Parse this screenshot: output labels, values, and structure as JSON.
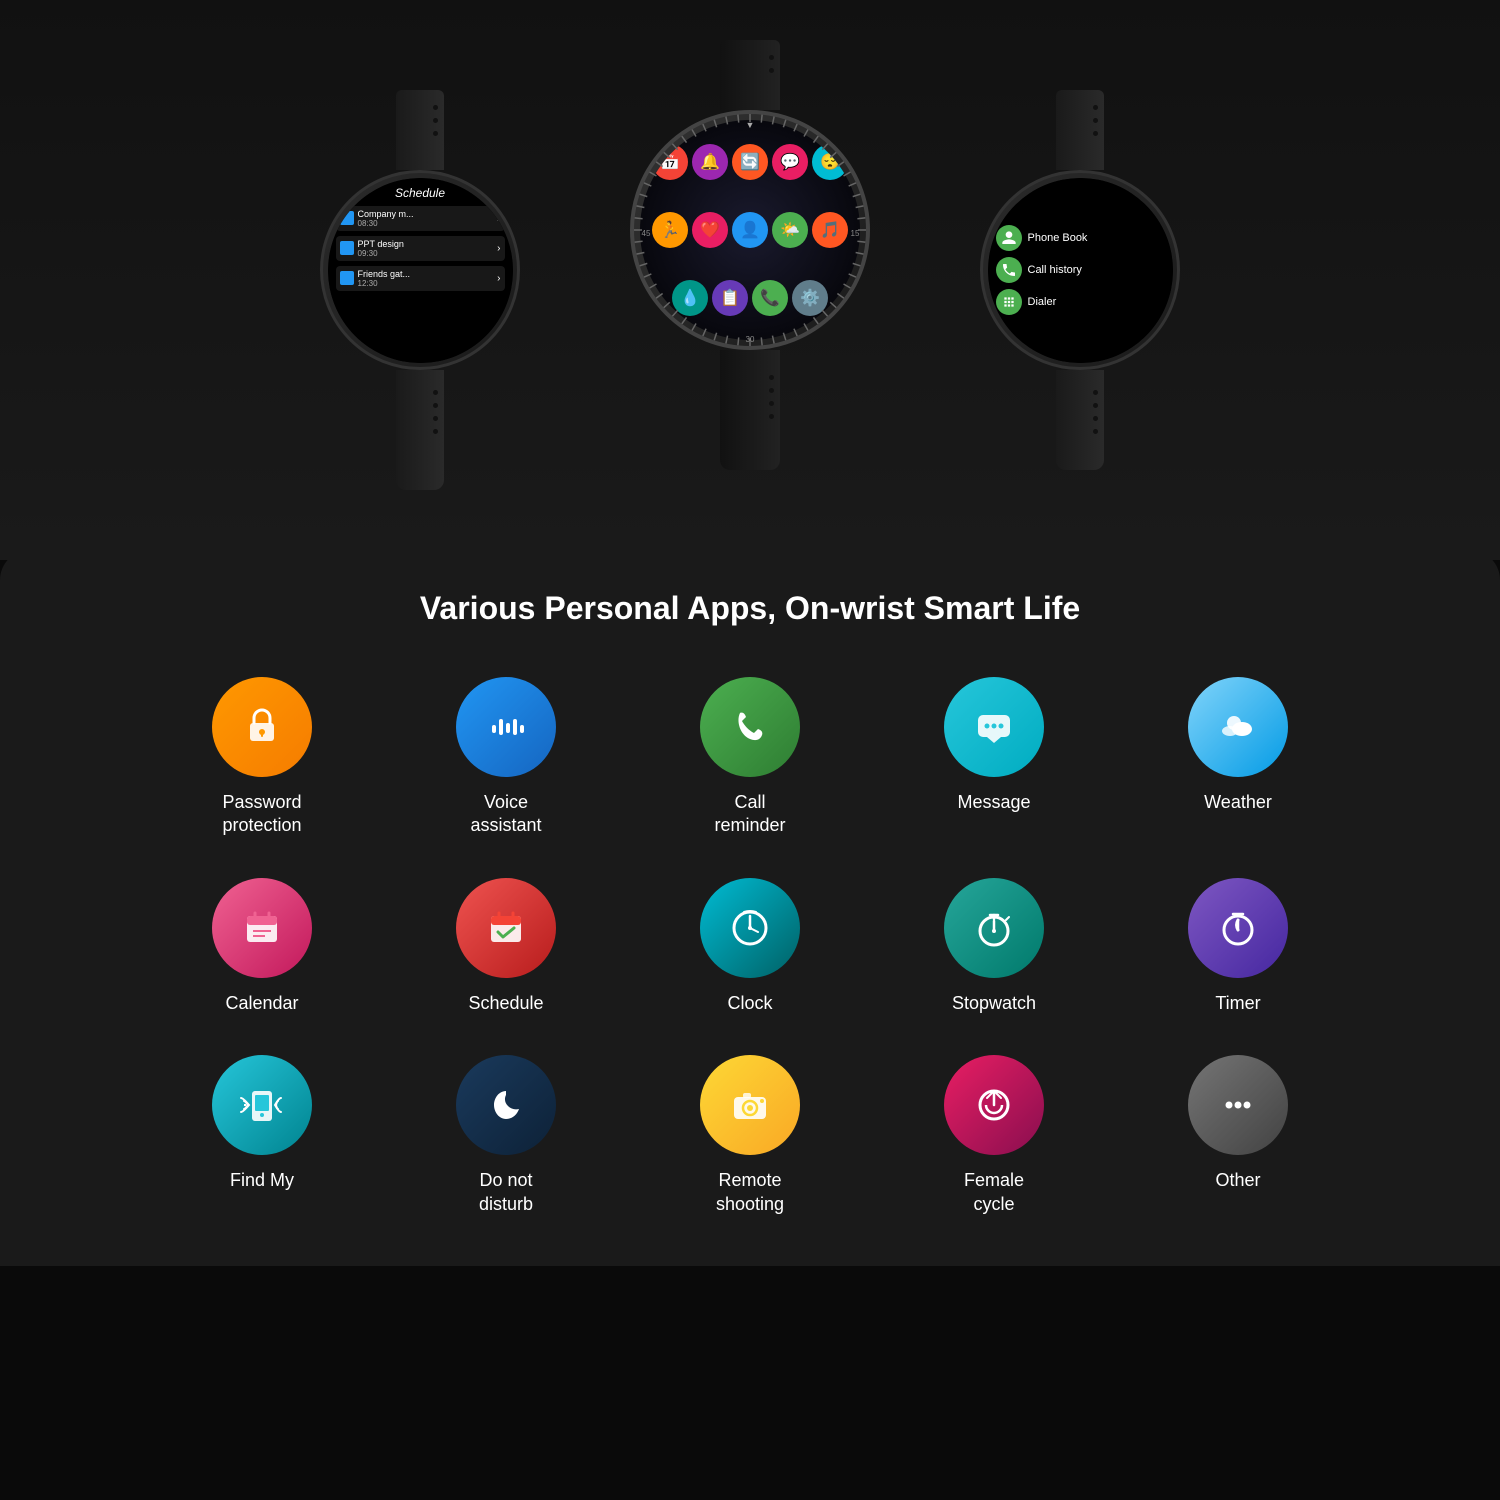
{
  "page": {
    "title": "Various Personal Apps, On-wrist Smart Life"
  },
  "watches": {
    "left": {
      "title": "Schedule",
      "items": [
        {
          "name": "Company m...",
          "time": "08:30"
        },
        {
          "name": "PPT design",
          "time": "09:30"
        },
        {
          "name": "Friends gat...",
          "time": "12:30"
        }
      ]
    },
    "right": {
      "items": [
        {
          "icon": "👤",
          "label": "Phone Book"
        },
        {
          "icon": "📞",
          "label": "Call history"
        },
        {
          "icon": "⌨️",
          "label": "Dialer"
        }
      ]
    }
  },
  "apps": [
    {
      "id": "password-protection",
      "label": "Password\nprotection",
      "color": "orange",
      "icon": "🔒"
    },
    {
      "id": "voice-assistant",
      "label": "Voice\nassistant",
      "color": "blue",
      "icon": "🎙️"
    },
    {
      "id": "call-reminder",
      "label": "Call\nreminder",
      "color": "green",
      "icon": "📞"
    },
    {
      "id": "message",
      "label": "Message",
      "color": "teal-light",
      "icon": "💬"
    },
    {
      "id": "weather",
      "label": "Weather",
      "color": "sky",
      "icon": "⛅"
    },
    {
      "id": "calendar",
      "label": "Calendar",
      "color": "pink",
      "icon": "📅"
    },
    {
      "id": "schedule",
      "label": "Schedule",
      "color": "red",
      "icon": "✅"
    },
    {
      "id": "clock",
      "label": "Clock",
      "color": "cyan",
      "icon": "⏰"
    },
    {
      "id": "stopwatch",
      "label": "Stopwatch",
      "color": "teal",
      "icon": "⏱️"
    },
    {
      "id": "timer",
      "label": "Timer",
      "color": "purple",
      "icon": "⏲️"
    },
    {
      "id": "find-my",
      "label": "Find My",
      "color": "teal2",
      "icon": "📱"
    },
    {
      "id": "do-not-disturb",
      "label": "Do not\ndisturb",
      "color": "dark-blue",
      "icon": "🌙"
    },
    {
      "id": "remote-shooting",
      "label": "Remote\nshooting",
      "color": "yellow",
      "icon": "📷"
    },
    {
      "id": "female-cycle",
      "label": "Female\ncycle",
      "color": "hot-pink",
      "icon": "♻️"
    },
    {
      "id": "other",
      "label": "Other",
      "color": "gray",
      "icon": "···"
    }
  ],
  "center_apps": [
    {
      "bg": "#F44336",
      "icon": "📅"
    },
    {
      "bg": "#9C27B0",
      "icon": "🔔"
    },
    {
      "bg": "#FF5722",
      "icon": "🔄"
    },
    {
      "bg": "#E91E63",
      "icon": "💬"
    },
    {
      "bg": "#00BCD4",
      "icon": "😴"
    },
    {
      "bg": "#FF9800",
      "icon": "🏃"
    },
    {
      "bg": "#E91E63",
      "icon": "❤️"
    },
    {
      "bg": "#2196F3",
      "icon": "👤"
    },
    {
      "bg": "#4CAF50",
      "icon": "🌤️"
    },
    {
      "bg": "#FF5722",
      "icon": "🎵"
    },
    {
      "bg": "#009688",
      "icon": "💧"
    },
    {
      "bg": "#673AB7",
      "icon": "📋"
    },
    {
      "bg": "#4CAF50",
      "icon": "📞"
    },
    {
      "bg": "#607D8B",
      "icon": "⚙️"
    }
  ]
}
